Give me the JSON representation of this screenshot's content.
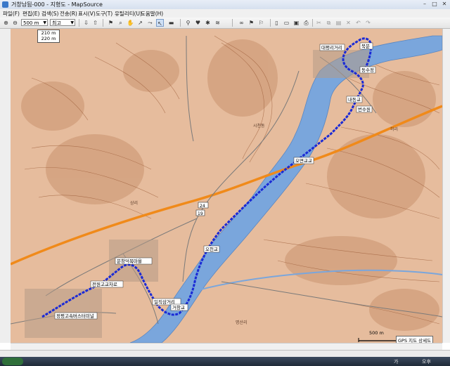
{
  "window": {
    "title": "거창남됨-000 - 지형도 - MapSource",
    "minimize": "–",
    "maximize": "□",
    "close": "✕"
  },
  "menu": [
    "파일(F)",
    "편집(E)",
    "검색(S)",
    "전송(R)",
    "표시(V)",
    "도구(T)",
    "유틸리티(U)",
    "도움말(H)"
  ],
  "toolbar": {
    "zoom_value": "500 m",
    "detail_value": "최고"
  },
  "map": {
    "scale_top": "210 m",
    "scale_bottom": "220 m",
    "scalebar_label": "500 m",
    "gps_info": "GPS 지도 상세도",
    "waypoints": [
      "대평리거리",
      "북문",
      "동수정",
      "내동교",
      "번수원",
      "오면교교",
      "오천교",
      "문창덕목마을",
      "전원고교차로",
      "일직삼거리",
      "거창교",
      "정평고속버스터미널"
    ],
    "place_labels": [
      "시천동",
      "하리",
      "상리",
      "명산리"
    ],
    "road_numbers": [
      "24",
      "19"
    ],
    "colors": {
      "track": "#1a2ad6",
      "river": "#7aa6dc",
      "highway": "#f08a1a",
      "terrain": "#e6bc9d"
    }
  },
  "taskbar": {
    "lang": "가",
    "clock": "오후"
  }
}
